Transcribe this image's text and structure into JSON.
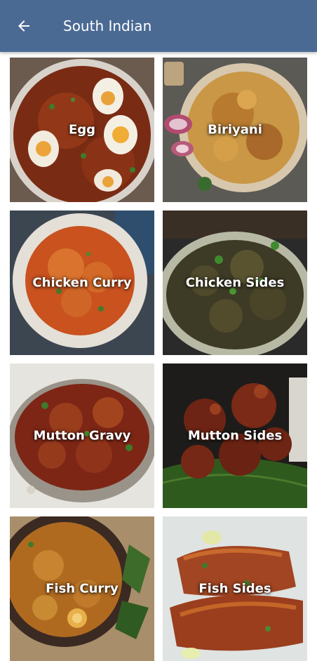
{
  "appbar": {
    "title": "South Indian",
    "back_icon": "arrow-back-icon",
    "background": "#4a6a94"
  },
  "categories": [
    {
      "label": "Egg",
      "icon": "egg-dish-photo"
    },
    {
      "label": "Biriyani",
      "icon": "biriyani-dish-photo"
    },
    {
      "label": "Chicken Curry",
      "icon": "chicken-curry-dish-photo"
    },
    {
      "label": "Chicken Sides",
      "icon": "chicken-sides-dish-photo"
    },
    {
      "label": "Mutton Gravy",
      "icon": "mutton-gravy-dish-photo"
    },
    {
      "label": "Mutton Sides",
      "icon": "mutton-sides-dish-photo"
    },
    {
      "label": "Fish Curry",
      "icon": "fish-curry-dish-photo"
    },
    {
      "label": "Fish Sides",
      "icon": "fish-sides-dish-photo"
    }
  ]
}
